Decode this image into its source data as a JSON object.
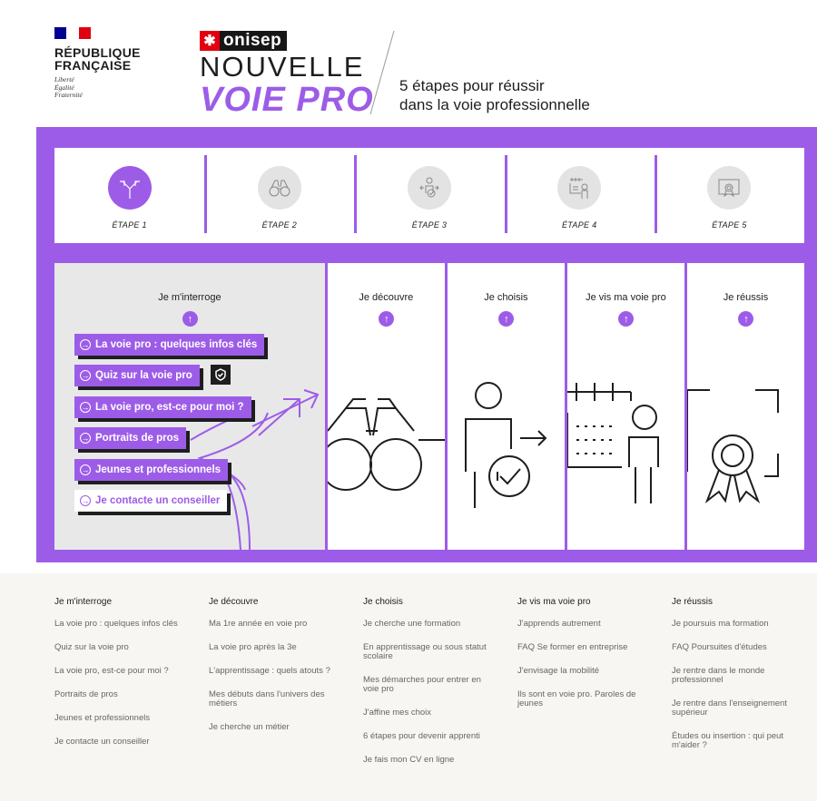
{
  "header": {
    "republique": {
      "line1": "RÉPUBLIQUE",
      "line2": "FRANÇAISE",
      "motto": [
        "Liberté",
        "Égalité",
        "Fraternité"
      ]
    },
    "onisep_logo": "onisep",
    "brand_line1": "NOUVELLE",
    "brand_line2": "VOIE PRO",
    "tagline_line1": "5 étapes pour réussir",
    "tagline_line2": "dans la voie professionnelle"
  },
  "steps": [
    {
      "label": "ÉTAPE 1",
      "icon": "crossroads-arrows-icon",
      "active": true
    },
    {
      "label": "ÉTAPE 2",
      "icon": "binoculars-icon",
      "active": false
    },
    {
      "label": "ÉTAPE 3",
      "icon": "person-choice-icon",
      "active": false
    },
    {
      "label": "ÉTAPE 4",
      "icon": "person-calendar-icon",
      "active": false
    },
    {
      "label": "ÉTAPE 5",
      "icon": "diploma-icon",
      "active": false
    }
  ],
  "panels": {
    "p1": {
      "title": "Je m'interroge"
    },
    "p2": {
      "title": "Je découvre"
    },
    "p3": {
      "title": "Je choisis"
    },
    "p4": {
      "title": "Je vis ma voie pro"
    },
    "p5": {
      "title": "Je réussis"
    }
  },
  "menu": [
    "La voie pro : quelques infos clés",
    "Quiz sur la voie pro",
    "La voie pro, est-ce pour moi ?",
    "Portraits de pros",
    "Jeunes et professionnels",
    "Je contacte un conseiller"
  ],
  "footer": {
    "columns": [
      {
        "title": "Je m'interroge",
        "links": [
          "La voie pro : quelques infos clés",
          "Quiz sur la voie pro",
          "La voie pro, est-ce pour moi ?",
          "Portraits de pros",
          "Jeunes et professionnels",
          "Je contacte un conseiller"
        ]
      },
      {
        "title": "Je découvre",
        "links": [
          "Ma 1re année en voie pro",
          "La voie pro après la 3e",
          "L'apprentissage : quels atouts ?",
          "Mes débuts dans l'univers des métiers",
          "Je cherche un métier"
        ]
      },
      {
        "title": "Je choisis",
        "links": [
          "Je cherche une formation",
          "En apprentissage ou sous statut scolaire",
          "Mes démarches pour entrer en voie pro",
          "J'affine mes choix",
          "6 étapes pour devenir apprenti",
          "Je fais mon CV en ligne"
        ]
      },
      {
        "title": "Je vis ma voie pro",
        "links": [
          "J'apprends autrement",
          "FAQ Se former en entreprise",
          "J'envisage la mobilité",
          "Ils sont en voie pro. Paroles de jeunes"
        ]
      },
      {
        "title": "Je réussis",
        "links": [
          "Je poursuis ma formation",
          "FAQ Poursuites d'études",
          "Je rentre dans le monde professionnel",
          "Je rentre dans l'enseignement supérieur",
          "Études ou insertion : qui peut m'aider ?"
        ]
      }
    ]
  },
  "colors": {
    "accent": "#9d5ce8",
    "dark": "#1e1e1e",
    "red": "#e1000f",
    "blue": "#000091"
  }
}
